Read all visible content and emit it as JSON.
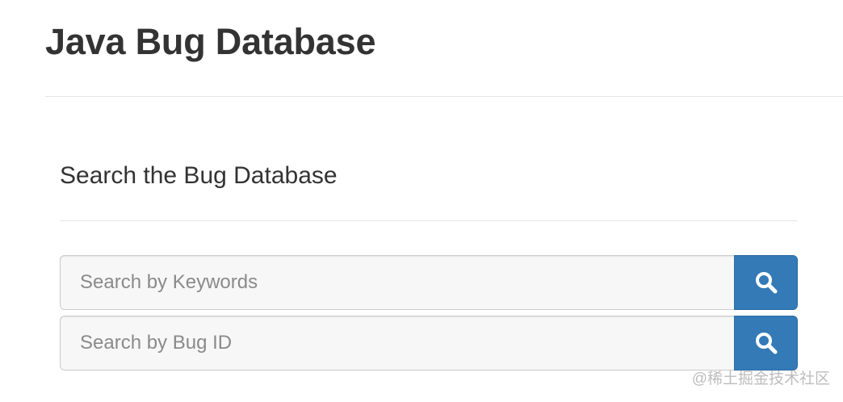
{
  "header": {
    "title": "Java Bug Database"
  },
  "search_panel": {
    "heading": "Search the Bug Database",
    "keywords": {
      "placeholder": "Search by Keywords",
      "value": "",
      "button_icon": "search-icon"
    },
    "bug_id": {
      "placeholder": "Search by Bug ID",
      "value": "",
      "button_icon": "search-icon"
    }
  },
  "watermark": {
    "text": "@稀土掘金技术社区"
  },
  "colors": {
    "primary_button": "#337ab7",
    "input_background": "#f7f7f7",
    "text": "#333333",
    "placeholder": "#8a8a8a"
  }
}
